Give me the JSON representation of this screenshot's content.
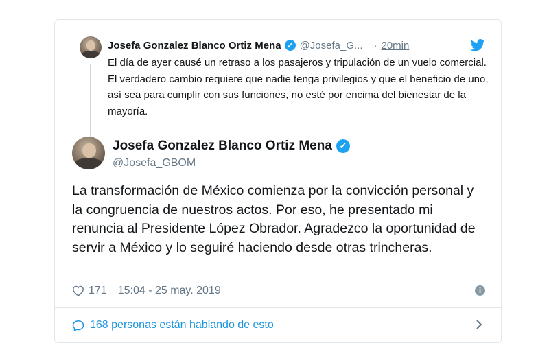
{
  "quoted_tweet": {
    "name": "Josefa Gonzalez Blanco Ortiz Mena",
    "handle": "@Josefa_G...",
    "separator": "·",
    "time": "20min",
    "text": "El día de ayer causé un retraso a los pasajeros y tripulación de un vuelo comercial.  El verdadero cambio requiere que nadie tenga privilegios y que el beneficio de uno, así sea para cumplir con sus funciones, no esté por encima del bienestar de la mayoría."
  },
  "main_tweet": {
    "name": "Josefa Gonzalez Blanco Ortiz Mena",
    "handle": "@Josefa_GBOM",
    "text": "La transformación de México comienza por la convicción personal y la congruencia de nuestros actos. Por eso, he presentado mi renuncia al Presidente López Obrador. Agradezco la oportunidad de servir a México y lo seguiré haciendo desde otras trincheras.",
    "likes": "171",
    "timestamp": "15:04 - 25 may. 2019"
  },
  "conversation": {
    "label": "168 personas están hablando de esto"
  },
  "icons": {
    "verified": "verified-badge",
    "bird": "twitter-bird-icon",
    "heart": "heart-icon",
    "info": "info-icon",
    "bubble": "speech-bubble-icon",
    "chevron": "chevron-right-icon",
    "info_glyph": "i",
    "check_glyph": "✓"
  },
  "colors": {
    "accent": "#1da1f2",
    "link": "#1b95e0",
    "secondary_text": "#657786",
    "border": "#e1e8ed"
  }
}
